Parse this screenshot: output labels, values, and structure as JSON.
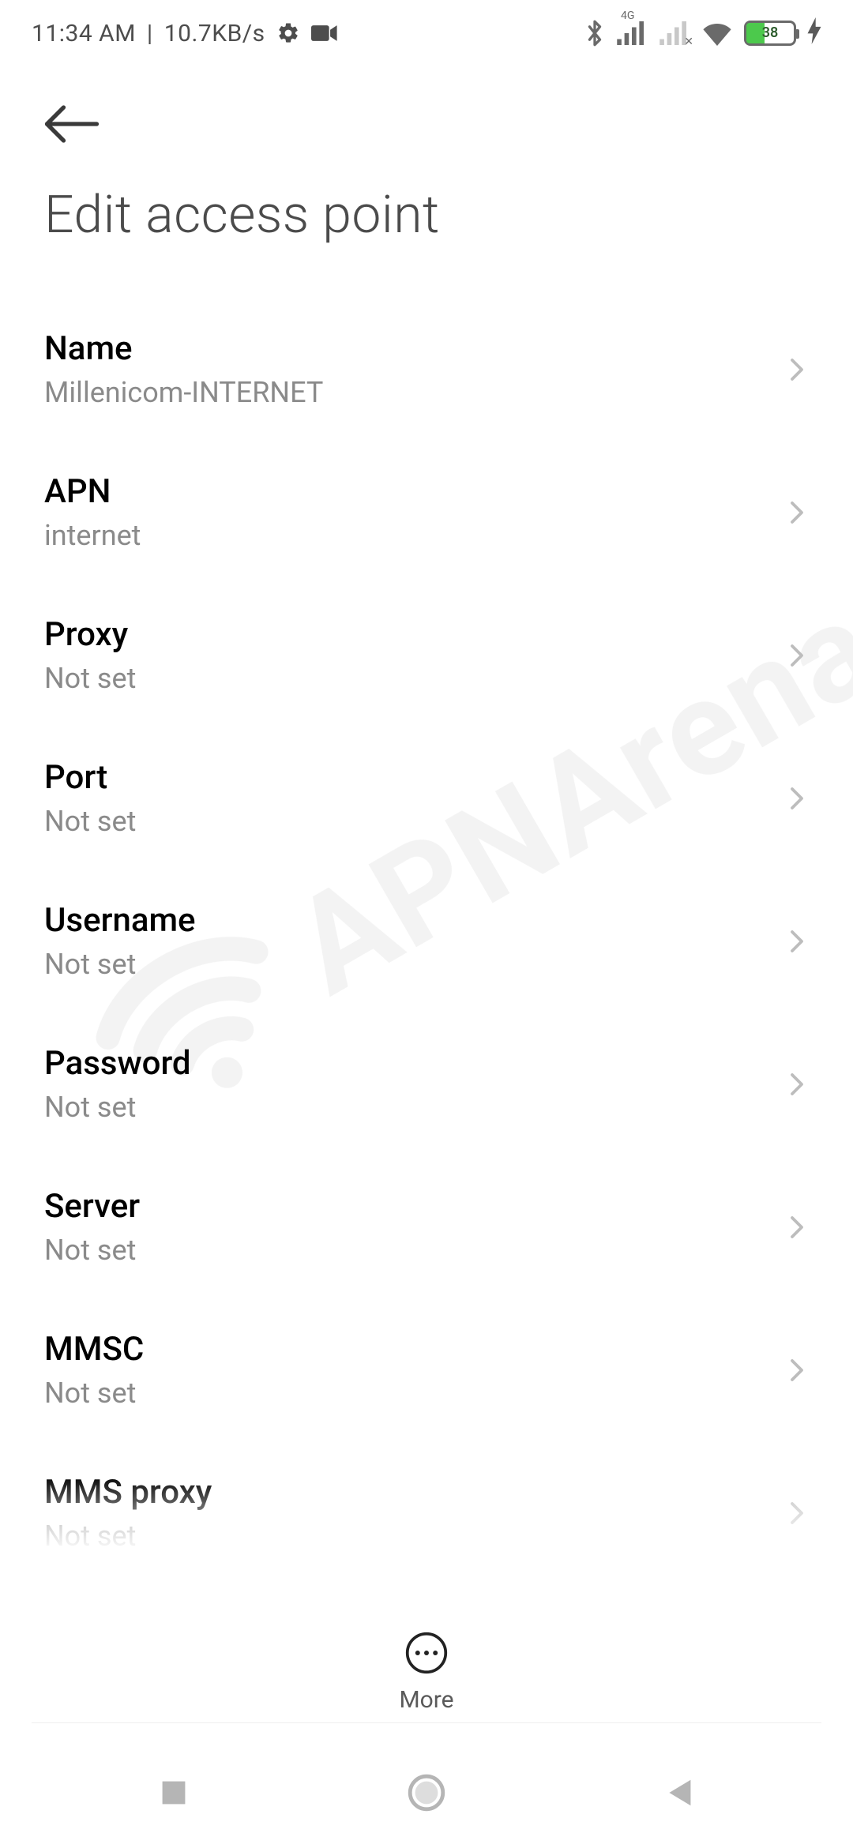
{
  "status": {
    "time": "11:34 AM",
    "separator": "|",
    "net_speed": "10.7KB/s",
    "sim1_type": "4G",
    "battery_pct": "38"
  },
  "header": {
    "title": "Edit access point"
  },
  "rows": [
    {
      "label": "Name",
      "value": "Millenicom-INTERNET"
    },
    {
      "label": "APN",
      "value": "internet"
    },
    {
      "label": "Proxy",
      "value": "Not set"
    },
    {
      "label": "Port",
      "value": "Not set"
    },
    {
      "label": "Username",
      "value": "Not set"
    },
    {
      "label": "Password",
      "value": "Not set"
    },
    {
      "label": "Server",
      "value": "Not set"
    },
    {
      "label": "MMSC",
      "value": "Not set"
    },
    {
      "label": "MMS proxy",
      "value": "Not set"
    }
  ],
  "bottom": {
    "more_label": "More"
  },
  "watermark": {
    "text": "APNArena"
  }
}
